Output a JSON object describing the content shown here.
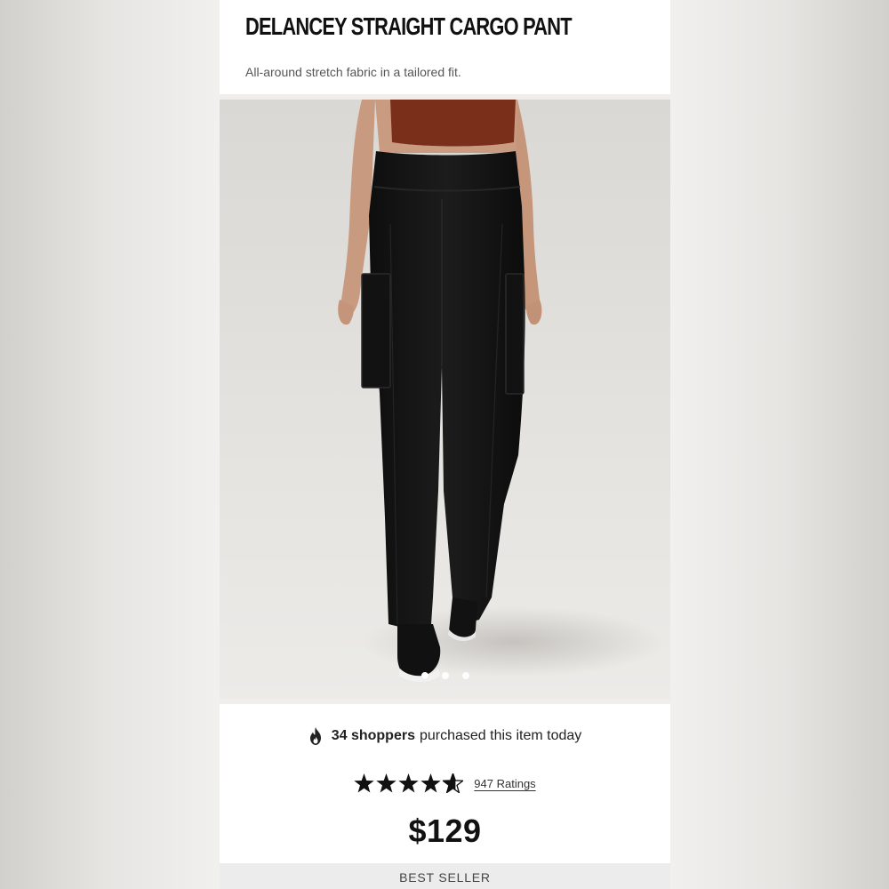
{
  "product": {
    "title": "DELANCEY STRAIGHT CARGO PANT",
    "subtitle": "All-around stretch fabric in a tailored fit."
  },
  "gallery": {
    "image_count": 3,
    "active_index": 0,
    "colors": {
      "pant": "#151515",
      "top": "#7a2f1b",
      "skin": "#c79a7f",
      "background": "#e2e0dc"
    }
  },
  "social_proof": {
    "icon": "flame-icon",
    "count_text": "34 shoppers",
    "rest_text": "purchased this item today"
  },
  "rating": {
    "stars": 4.5,
    "max_stars": 5,
    "ratings_text": "947 Ratings"
  },
  "price": "$129",
  "badge": "BEST SELLER"
}
